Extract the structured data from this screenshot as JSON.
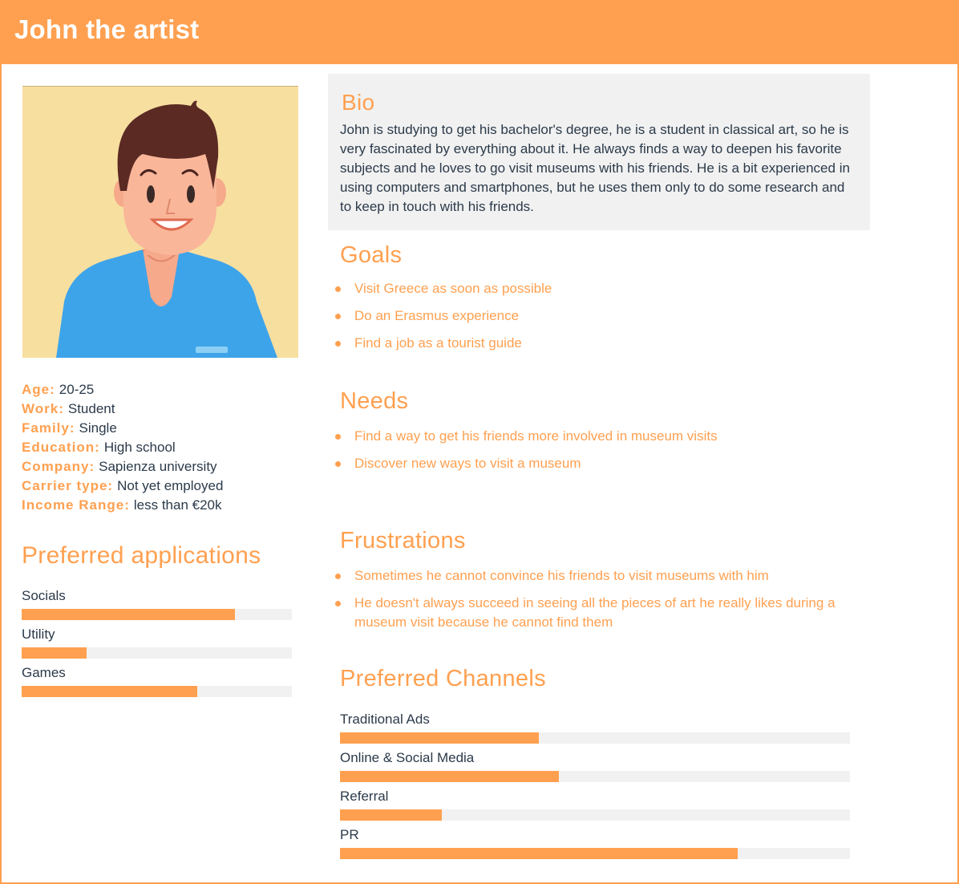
{
  "header": {
    "title": "John the artist"
  },
  "facts": [
    {
      "key": "Age:",
      "value": "20-25"
    },
    {
      "key": "Work:",
      "value": "Student"
    },
    {
      "key": "Family:",
      "value": "Single"
    },
    {
      "key": "Education:",
      "value": "High school"
    },
    {
      "key": "Company:",
      "value": "Sapienza university"
    },
    {
      "key": "Carrier type:",
      "value": "Not yet employed"
    },
    {
      "key": "Income Range:",
      "value": "less than €20k"
    }
  ],
  "preferred_applications": {
    "title": "Preferred applications",
    "items": [
      {
        "label": "Socials",
        "level": 0.79
      },
      {
        "label": "Utility",
        "level": 0.24
      },
      {
        "label": "Games",
        "level": 0.65
      }
    ]
  },
  "bio": {
    "title": "Bio",
    "text": "John is studying to get his bachelor's degree, he is a student in classical art, so he is very fascinated by everything about it. He always finds a way to deepen his favorite subjects and he loves to go visit museums with his friends. He is a bit experienced in using computers and smartphones, but he uses them only to do some research and to keep in touch with his friends."
  },
  "goals": {
    "title": "Goals",
    "items": [
      "Visit Greece as soon as possible",
      "Do an Erasmus experience",
      "Find a job as a tourist guide"
    ]
  },
  "needs": {
    "title": "Needs",
    "items": [
      "Find a way to get his friends more involved in museum visits",
      "Discover new ways to visit a museum"
    ]
  },
  "frustrations": {
    "title": "Frustrations",
    "items": [
      "Sometimes he cannot convince his friends to visit museums with him",
      "He doesn't always succeed in  seeing all the pieces of art he really likes during a museum visit because he cannot find them"
    ]
  },
  "preferred_channels": {
    "title": "Preferred Channels",
    "items": [
      {
        "label": "Traditional Ads",
        "level": 0.39
      },
      {
        "label": "Online & Social Media",
        "level": 0.43
      },
      {
        "label": "Referral",
        "level": 0.2
      },
      {
        "label": "PR",
        "level": 0.78
      }
    ]
  },
  "colors": {
    "accent": "#ffa050",
    "text": "#2b3a4a",
    "panel": "#f1f1f1",
    "avatar_bg": "#f7dfa0"
  }
}
